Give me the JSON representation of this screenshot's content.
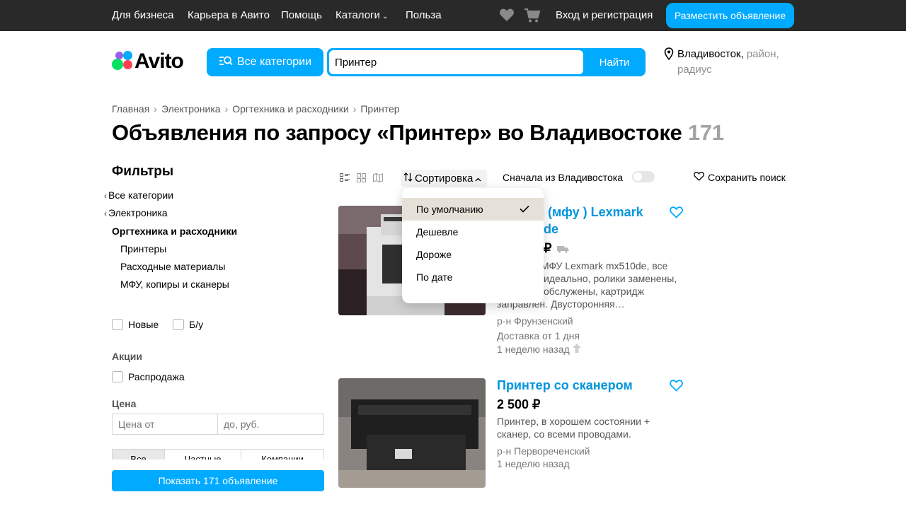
{
  "topbar": {
    "links": [
      "Для бизнеса",
      "Карьера в Авито",
      "Помощь",
      "Каталоги",
      "Польза"
    ],
    "login": "Вход и регистрация",
    "post_ad": "Разместить объявление"
  },
  "header": {
    "logo_text": "Avito",
    "categories_button": "Все категории",
    "search_value": "Принтер",
    "search_button": "Найти",
    "location_city": "Владивосток,",
    "location_district": "район,",
    "location_radius": "радиус"
  },
  "breadcrumb": [
    "Главная",
    "Электроника",
    "Оргтехника и расходники",
    "Принтер"
  ],
  "title": {
    "text": "Объявления по запросу «Принтер» во Владивостоке",
    "count": "171"
  },
  "filters": {
    "heading": "Фильтры",
    "nav": [
      "Все категории",
      "Электроника"
    ],
    "current_category": "Оргтехника и расходники",
    "subcategories": [
      "Принтеры",
      "Расходные материалы",
      "МФУ, копиры и сканеры"
    ],
    "condition": [
      "Новые",
      "Б/у"
    ],
    "promo_heading": "Акции",
    "sale": "Распродажа",
    "price_heading": "Цена",
    "price_from_placeholder": "Цена от",
    "price_to_placeholder": "до, руб.",
    "seller_segments": [
      "Все",
      "Частные",
      "Компании"
    ],
    "show_button": "Показать 171 объявление"
  },
  "toolbar": {
    "sort_label": "Сортировка",
    "city_first": "Сначала из Владивостока",
    "save_search": "Сохранить поиск"
  },
  "sort_menu": {
    "options": [
      "По умолчанию",
      "Дешевле",
      "Дороже",
      "По дате"
    ],
    "selected": "По умолчанию"
  },
  "listings": [
    {
      "title_line1": "р (мфу ) Lexmark",
      "title_line2": "de",
      "price": "₽",
      "desc": [
        "МФУ Lexmark mx510de, все",
        "идеально, ролики заменены,",
        "обслужены, картридж",
        "заправлен. Двусторонняя…"
      ],
      "district": "р-н Фрунзенский",
      "delivery": "Доставка от 1 дня",
      "date": "1 неделю назад"
    },
    {
      "title_line1": "Принтер со сканером",
      "price": "2 500 ₽",
      "desc": [
        "Принтер, в хорошем состоянии +",
        "сканер, со всеми проводами."
      ],
      "district": "р-н Первореченский",
      "date": "1 неделю назад"
    }
  ],
  "colors": {
    "accent": "#00aaff",
    "topbar": "#292929",
    "link_title": "#0095dd",
    "selected_option": "#e6e1d8"
  }
}
